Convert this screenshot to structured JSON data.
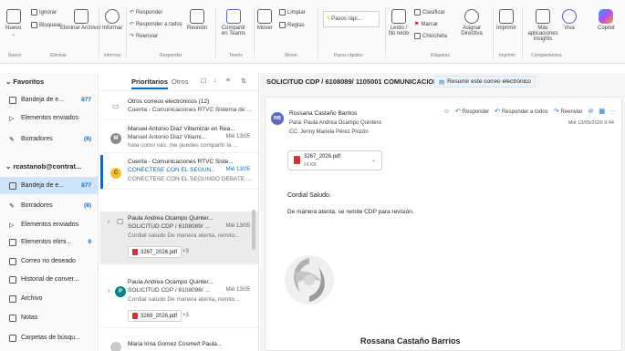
{
  "ribbon": {
    "new": {
      "label": "Nuevo",
      "sub": "Nuevo"
    },
    "ignore": "Ignorar",
    "block": "Bloquear",
    "delete_archive": "Eliminar Archivar",
    "report": "Informar",
    "reply": "Responder",
    "reply_all": "Responder a todos",
    "forward": "Reenviar",
    "meeting": "Reunión",
    "share_teams": "Compartir en Teams",
    "move": "Mover",
    "clean": "Limpiar",
    "rules": "Reglas",
    "quick_steps": "Pasos rápi...",
    "read_unread": "Leído / No leído",
    "categorize": "Clasificar",
    "flag": "Marcar",
    "pin": "Chincheta",
    "policy": "Asignar Directiva",
    "print": "Imprimir",
    "apps": "Más aplicaciones Insights",
    "viva": "Viva",
    "copilot": "Copilot",
    "groups": {
      "new": "Nuevo",
      "delete": "Eliminar",
      "report": "Informar",
      "respond": "Responder",
      "teams": "Teams",
      "move": "Mover",
      "quick": "Pasos rápidos",
      "tags": "Etiquetas",
      "print": "Imprimir",
      "addins": "Complementos"
    }
  },
  "folders": {
    "favorites_header": "Favoritos",
    "favorites": [
      {
        "label": "Bandeja de e...",
        "count": "877"
      },
      {
        "label": "Elementos enviados",
        "count": ""
      },
      {
        "label": "Borradores",
        "count": "(8)"
      }
    ],
    "account_header": "rcastanob@contrat...",
    "account": [
      {
        "label": "Bandeja de e...",
        "count": "877"
      },
      {
        "label": "Borradores",
        "count": "(8)"
      },
      {
        "label": "Elementos enviados",
        "count": ""
      },
      {
        "label": "Elementos elimi...",
        "count": "9"
      },
      {
        "label": "Correo no deseado",
        "count": ""
      },
      {
        "label": "Historial de conver...",
        "count": ""
      },
      {
        "label": "Archivo",
        "count": ""
      },
      {
        "label": "Notas",
        "count": ""
      },
      {
        "label": "Carpetas de búsqu...",
        "count": ""
      }
    ]
  },
  "list": {
    "tab_focused": "Prioritarios",
    "tab_other": "Otros",
    "items": [
      {
        "avatar": "",
        "l1": "Otros correos electrónicos (12)",
        "l2": "Cuenta - Comunicaciones RTVC Sistema de ...",
        "l3": "",
        "date": ""
      },
      {
        "avatar": "M",
        "l1": "Manuel Antonio Diaz Villamizar en Rea...",
        "l2": "Manuel Antonio Diaz Villami...",
        "l3": "hola como vas, me puedes compartir la ...",
        "date": "Mié 13/05"
      },
      {
        "avatar": "C",
        "l1": "Cuenta - Comunicaciones RTVC Siste...",
        "l2": "CONÉCTESE CON EL SEGUN...",
        "l3": "CONÉCTESE CON EL SEGUNDO DEBATE ...",
        "date": "Mié 13/05"
      },
      {
        "avatar": "",
        "l1": "Paula Andrea Ocampo Quinter...",
        "l2": "SOLICITUD CDP / 6108089/ ...",
        "l3": "Cordial saludo De manera atenta, remito...",
        "date": "Mié 13/05",
        "chip": "3267_2026.pdf",
        "plus": "+3"
      },
      {
        "avatar": "P",
        "l1": "Paula Andrea Ocampo Quinter...",
        "l2": "SOLICITUD CDP / 6108096/ ...",
        "l3": "Cordial saludo De manera atenta, remito...",
        "date": "Mié 13/05",
        "chip": "3269_2026.pdf",
        "plus": "+3"
      },
      {
        "avatar": "",
        "l1": "Maria Irina Gomez Cosme/t Paula...",
        "l2": "",
        "l3": "",
        "date": ""
      }
    ]
  },
  "reading": {
    "subject": "SOLICITUD CDP / 6108089/ 1105001 COMUNICACIONES",
    "summary": "Resumir este correo electrónico",
    "avatar": "RB",
    "sender": "Rossana Castaño Barrios",
    "to": "Para: Paula Andrea Ocampo Quintero",
    "cc": "CC: Jenny Mariela Pérez Pinzón",
    "date": "Mié 13/05/2026 9:44",
    "actions": {
      "reply": "Responder",
      "reply_all": "Responder a todos",
      "forward": "Reenviar"
    },
    "attachment": {
      "name": "3267_2026.pdf",
      "size": "64 KB"
    },
    "body1": "Cordial Saludo.",
    "body2": "De manera atenta, se remite CDP para revisión.",
    "signature": "Rossana Castaño Barrios"
  },
  "colors": {
    "accent": "#0f6cbd",
    "selected": "#cfe4fa",
    "pdf": "#d13438"
  }
}
